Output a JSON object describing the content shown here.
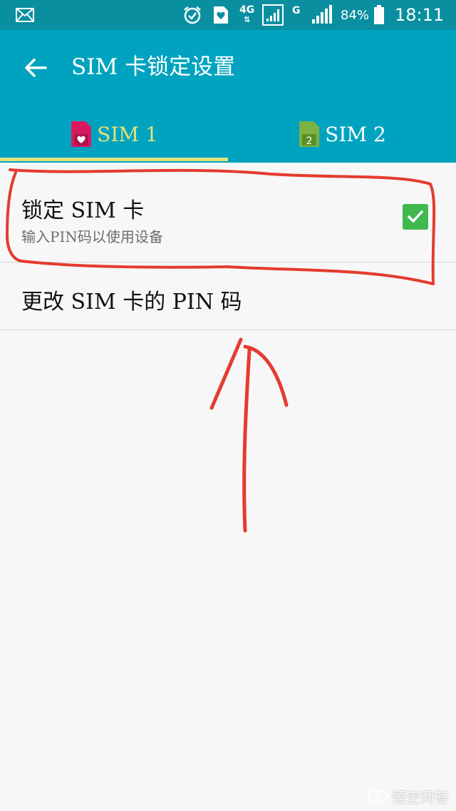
{
  "status_bar": {
    "network": "4G",
    "carrier_network": "G",
    "battery": "84%",
    "time": "18:11",
    "icons": [
      "mail-icon",
      "alarm-icon",
      "heart-sim-icon",
      "signal-icon",
      "battery-icon"
    ]
  },
  "app_bar": {
    "title": "SIM 卡锁定设置",
    "back_icon": "arrow-left-icon"
  },
  "tabs": [
    {
      "label": "SIM 1",
      "icon": "sim1-heart-icon",
      "selected": true,
      "color": "#e3e27a"
    },
    {
      "label": "SIM 2",
      "icon": "sim2-icon",
      "icon_text": "2",
      "selected": false,
      "color": "#ffffff"
    }
  ],
  "settings": [
    {
      "title": "锁定 SIM 卡",
      "subtitle": "输入PIN码以使用设备",
      "checked": true
    },
    {
      "title": "更改 SIM 卡的 PIN 码"
    }
  ],
  "watermark": {
    "text": "悟空问答"
  },
  "colors": {
    "status_bar": "#0a8fa0",
    "app_bar": "#00a3bf",
    "checkbox": "#3fb94d",
    "annotation": "#e53b2f",
    "sim1_icon": "#d81b60",
    "sim2_icon": "#7cb342"
  }
}
